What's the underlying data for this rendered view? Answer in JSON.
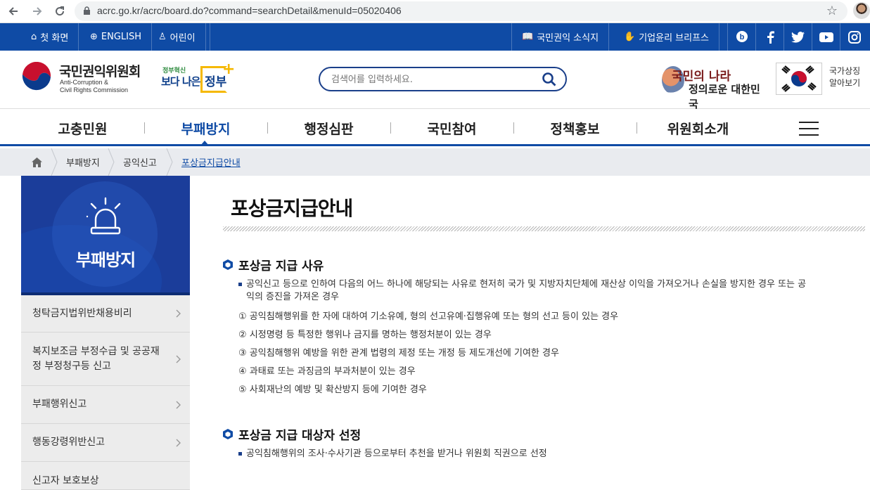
{
  "browser": {
    "url": "acrc.go.kr/acrc/board.do?command=searchDetail&menuId=05020406",
    "back_icon": "back-arrow-icon",
    "forward_icon": "forward-arrow-icon",
    "reload_icon": "reload-icon"
  },
  "util": {
    "home": "첫 화면",
    "english": "ENGLISH",
    "kids": "어린이",
    "newsletter": "국민권익 소식지",
    "ethics": "기업윤리 브리프스"
  },
  "header": {
    "logo_ko": "국민권익위원회",
    "logo_en_1": "Anti-Corruption &",
    "logo_en_2": "Civil Rights Commission",
    "gov_small": "정부혁신",
    "gov_big": "보다 나은",
    "gov_word": "정부",
    "search_placeholder": "검색어를 입력하세요.",
    "slogan_1": "국민의 나라",
    "slogan_2": "정의로운 대한민국",
    "flag_text_1": "국가상징",
    "flag_text_2": "알아보기"
  },
  "gnb": [
    "고충민원",
    "부패방지",
    "행정심판",
    "국민참여",
    "정책홍보",
    "위원회소개"
  ],
  "breadcrumb": [
    "부패방지",
    "공익신고",
    "포상금지급안내"
  ],
  "sidebar": {
    "title": "부패방지",
    "items": [
      "청탁금지법위반채용비리",
      "복지보조금 부정수급 및 공공재정 부정청구등 신고",
      "부패행위신고",
      "행동강령위반신고",
      "신고자 보호보상"
    ]
  },
  "content": {
    "title": "포상금지급안내",
    "section1": {
      "heading": "포상금 지급 사유",
      "bullet_1": "공익신고 등으로 인하여 다음의 어느 하나에 해당되는 사유로 현저히 국가 및 지방자치단체에 재산상 이익을 가져오거나 손실을 방지한 경우 또는 공",
      "bullet_2": "익의 증진을 가져온 경우",
      "items": [
        "① 공익침해행위를 한 자에 대하여 기소유예, 형의 선고유예·집행유예 또는 형의 선고 등이 있는 경우",
        "② 시정명령 등 특정한 행위나 금지를 명하는 행정처분이 있는 경우",
        "③ 공익침해행위 예방을 위한 관계 법령의 제정 또는 개정 등 제도개선에 기여한 경우",
        "④ 과태료 또는 과징금의 부과처분이 있는 경우",
        "⑤ 사회재난의 예방 및 확산방지 등에 기여한 경우"
      ]
    },
    "section2": {
      "heading": "포상금 지급 대상자 선정",
      "bullet": "공익침해행위의 조사·수사기관 등으로부터 추천을 받거나 위원회 직권으로 선정"
    }
  },
  "colors": {
    "brand": "#0f4ba5",
    "sidebar": "#1b3d9a",
    "breadcrumb_bg": "#e9ebef"
  }
}
